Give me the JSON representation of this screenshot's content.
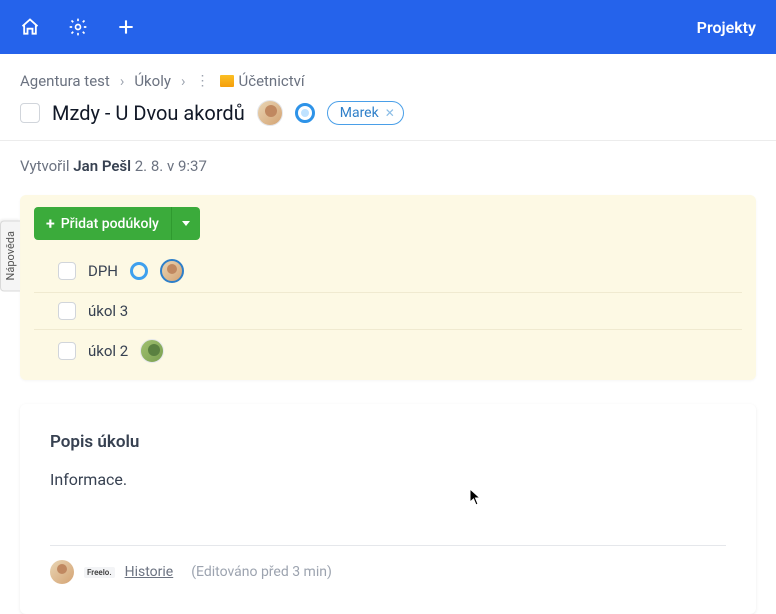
{
  "topbar": {
    "right_link": "Projekty"
  },
  "breadcrumb": {
    "project": "Agentura test",
    "section": "Úkoly",
    "list": "Účetnictví"
  },
  "task": {
    "title": "Mzdy - U Dvou akordů",
    "tag": {
      "label": "Marek"
    }
  },
  "meta": {
    "prefix": "Vytvořil ",
    "author": "Jan Pešl",
    "suffix": " 2. 8. v 9:37"
  },
  "subtasks": {
    "add_label": "Přidat podúkoly",
    "items": [
      {
        "name": "DPH",
        "ring": true,
        "avatar": true
      },
      {
        "name": "úkol 3",
        "ring": false,
        "avatar": false
      },
      {
        "name": "úkol 2",
        "ring": false,
        "avatar": "g"
      }
    ]
  },
  "description": {
    "heading": "Popis úkolu",
    "body": "Informace.",
    "badge": "Freelo.",
    "history_link": "Historie",
    "edited_note": "(Editováno před 3 min)"
  },
  "help_tab": "Nápověda"
}
